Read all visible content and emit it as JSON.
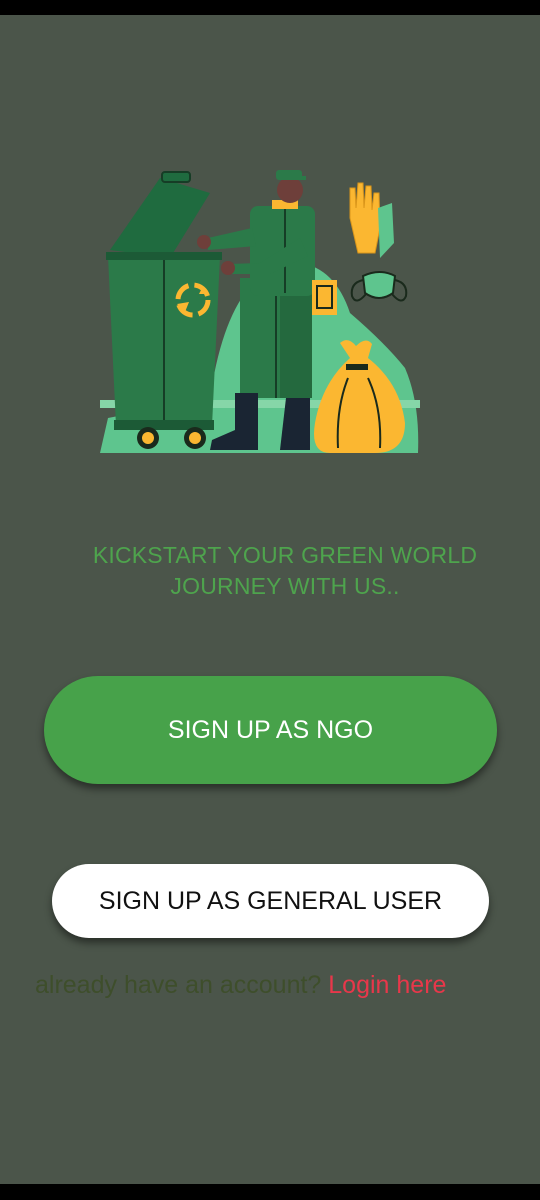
{
  "colors": {
    "background": "#4b554a",
    "accent_green": "#47a24a",
    "tagline_green": "#4ea44d",
    "login_link_red": "#e8374a",
    "prompt_dark_green": "#3e4e2b",
    "illustration_dark_green": "#1f6b3f",
    "illustration_mint": "#5ec58e",
    "illustration_yellow": "#fbb731"
  },
  "tagline": {
    "line1": "KICKSTART YOUR GREEN WORLD",
    "line2": "JOURNEY WITH US.."
  },
  "buttons": {
    "ngo_label": "SIGN UP AS NGO",
    "user_label": "SIGN UP AS GENERAL USER"
  },
  "login": {
    "prompt": "already have an account? ",
    "link": "Login here"
  },
  "illustration": {
    "icons": [
      "recycle-icon",
      "gloves-icon",
      "mask-icon",
      "trash-bag-icon"
    ]
  }
}
